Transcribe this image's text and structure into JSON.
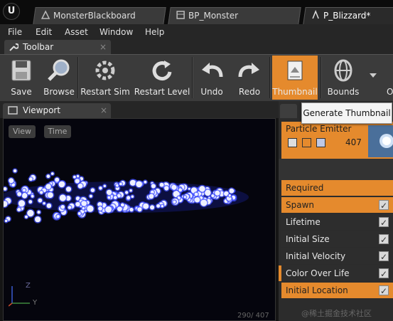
{
  "tabs": [
    {
      "label": "MonsterBlackboard",
      "active": false
    },
    {
      "label": "BP_Monster",
      "active": false
    },
    {
      "label": "P_Blizzard*",
      "active": true
    }
  ],
  "menu": [
    "File",
    "Edit",
    "Asset",
    "Window",
    "Help"
  ],
  "toolbar": {
    "tab_label": "Toolbar",
    "buttons": [
      {
        "label": "Save",
        "icon": "save-icon"
      },
      {
        "label": "Browse",
        "icon": "browse-icon"
      },
      {
        "label": "Restart Sim",
        "icon": "restart-sim-icon"
      },
      {
        "label": "Restart Level",
        "icon": "restart-level-icon"
      },
      {
        "label": "Undo",
        "icon": "undo-icon"
      },
      {
        "label": "Redo",
        "icon": "redo-icon"
      },
      {
        "label": "Thumbnail",
        "icon": "thumbnail-icon",
        "selected": true
      },
      {
        "label": "Bounds",
        "icon": "bounds-icon"
      },
      {
        "label": "O",
        "icon": "more-icon"
      }
    ]
  },
  "tooltip": "Generate Thumbnail",
  "viewport": {
    "tab_label": "Viewport",
    "view_button": "View",
    "time_button": "Time",
    "counter": "290/ 407",
    "axis_z": "Z",
    "axis_y": "Y"
  },
  "emitter": {
    "name": "Particle Emitter",
    "count": "407"
  },
  "modules": [
    {
      "label": "Required",
      "style": "orange",
      "checkbox": false
    },
    {
      "label": "Spawn",
      "style": "orange",
      "checkbox": true
    },
    {
      "label": "Lifetime",
      "style": "gray",
      "checkbox": true
    },
    {
      "label": "Initial Size",
      "style": "gray",
      "checkbox": true
    },
    {
      "label": "Initial Velocity",
      "style": "gray",
      "checkbox": true
    },
    {
      "label": "Color Over Life",
      "style": "gray-accent",
      "checkbox": true
    },
    {
      "label": "Initial Location",
      "style": "orange",
      "checkbox": true
    }
  ],
  "watermark": "@稀土掘金技术社区",
  "colors": {
    "accent": "#e58a2d",
    "particle": "#3d4cff"
  }
}
